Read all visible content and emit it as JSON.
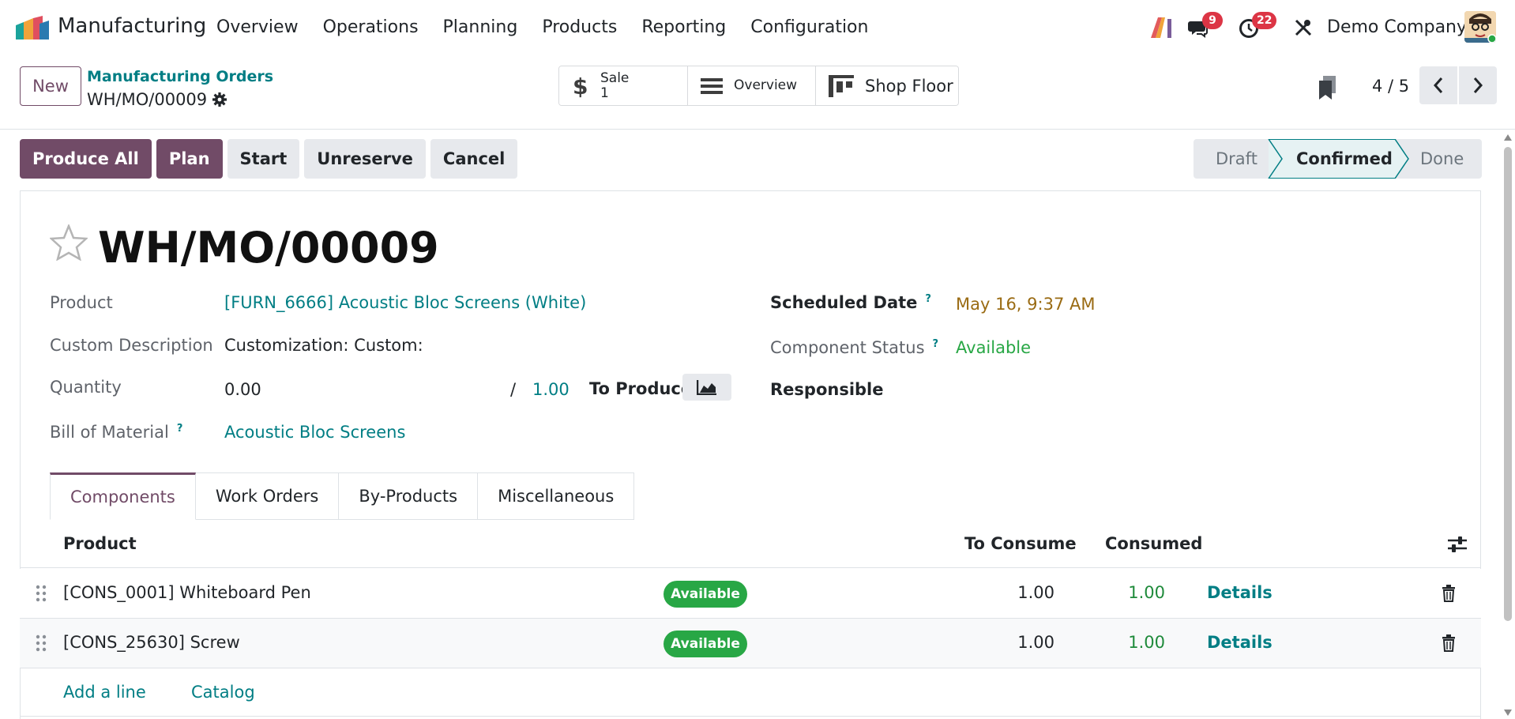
{
  "nav": {
    "app_name": "Manufacturing",
    "menu": [
      "Overview",
      "Operations",
      "Planning",
      "Products",
      "Reporting",
      "Configuration"
    ],
    "messages_badge": "9",
    "activities_badge": "22",
    "company": "Demo Company"
  },
  "control": {
    "new_label": "New",
    "breadcrumb_parent": "Manufacturing Orders",
    "breadcrumb_current": "WH/MO/00009",
    "smart_buttons": {
      "sale_label": "Sale",
      "sale_count": "1",
      "overview_label": "Overview",
      "shop_floor_label": "Shop Floor"
    },
    "pager": "4 / 5"
  },
  "actions": {
    "produce_all": "Produce All",
    "plan": "Plan",
    "start": "Start",
    "unreserve": "Unreserve",
    "cancel": "Cancel"
  },
  "status": {
    "draft": "Draft",
    "confirmed": "Confirmed",
    "done": "Done",
    "active": "Confirmed"
  },
  "form": {
    "title": "WH/MO/00009",
    "product_label": "Product",
    "product_value": "[FURN_6666] Acoustic Bloc Screens (White)",
    "custom_desc_label": "Custom Description",
    "custom_desc_value": "Customization: Custom:",
    "quantity_label": "Quantity",
    "quantity_value": "0.00",
    "quantity_sep": "/",
    "quantity_target": "1.00",
    "to_produce": "To Produce",
    "bom_label": "Bill of Material",
    "bom_value": "Acoustic Bloc Screens",
    "scheduled_label": "Scheduled Date",
    "scheduled_value": "May 16, 9:37 AM",
    "component_status_label": "Component Status",
    "component_status_value": "Available",
    "responsible_label": "Responsible",
    "help_mark": "?"
  },
  "tabs": [
    "Components",
    "Work Orders",
    "By-Products",
    "Miscellaneous"
  ],
  "table": {
    "headers": {
      "product": "Product",
      "to_consume": "To Consume",
      "consumed": "Consumed"
    },
    "rows": [
      {
        "product": "[CONS_0001] Whiteboard Pen",
        "status": "Available",
        "to_consume": "1.00",
        "consumed": "1.00",
        "details": "Details"
      },
      {
        "product": "[CONS_25630] Screw",
        "status": "Available",
        "to_consume": "1.00",
        "consumed": "1.00",
        "details": "Details"
      }
    ],
    "add_line": "Add a line",
    "catalog": "Catalog"
  },
  "colors": {
    "brand": "#714b67",
    "link": "#017e84",
    "available": "#28a745",
    "danger": "#dc3545"
  },
  "icons": [
    "app-logo",
    "ai-icon",
    "chat-icon",
    "clock-icon",
    "tools-icon",
    "gear-icon",
    "dollar-icon",
    "list-icon",
    "shop-floor-icon",
    "bookmark-icon",
    "chevron-left-icon",
    "chevron-right-icon",
    "star-icon",
    "area-chart-icon",
    "drag-handle-icon",
    "sliders-icon",
    "trash-icon"
  ]
}
